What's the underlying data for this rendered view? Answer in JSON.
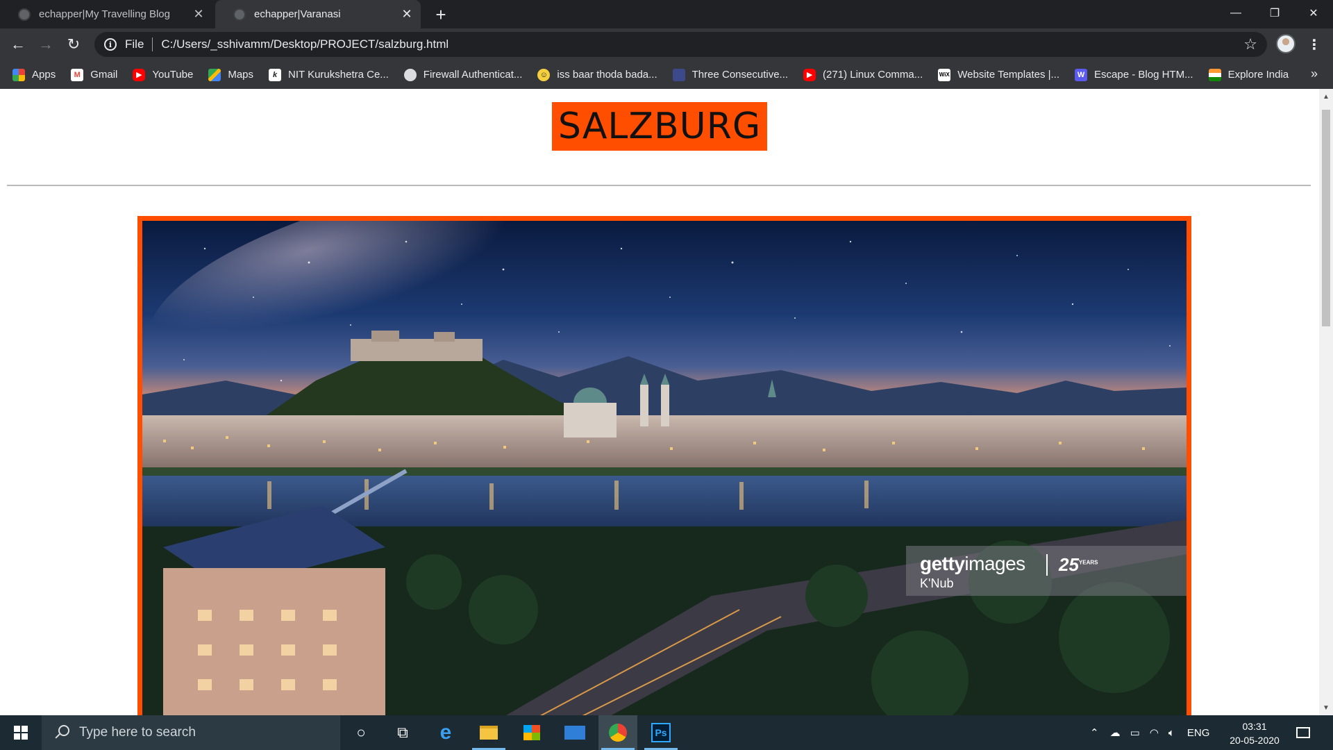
{
  "browser": {
    "tabs": [
      {
        "title": "echapper|My Travelling Blog",
        "active": false
      },
      {
        "title": "echapper|Varanasi",
        "active": true
      }
    ],
    "omnibox": {
      "scheme": "File",
      "url": "C:/Users/_sshivamm/Desktop/PROJECT/salzburg.html"
    },
    "bookmarks": [
      {
        "label": "Apps",
        "icon": "apps-grid-icon"
      },
      {
        "label": "Gmail",
        "icon": "gmail-icon"
      },
      {
        "label": "YouTube",
        "icon": "youtube-icon"
      },
      {
        "label": "Maps",
        "icon": "maps-icon"
      },
      {
        "label": "NIT Kurukshetra Ce...",
        "icon": "nit-icon"
      },
      {
        "label": "Firewall Authenticat...",
        "icon": "globe-icon"
      },
      {
        "label": "iss baar thoda bada...",
        "icon": "smiley-icon"
      },
      {
        "label": "Three Consecutive...",
        "icon": "page-icon"
      },
      {
        "label": "(271) Linux Comma...",
        "icon": "youtube-icon"
      },
      {
        "label": "Website Templates |...",
        "icon": "wix-icon"
      },
      {
        "label": "Escape - Blog HTM...",
        "icon": "w-icon"
      },
      {
        "label": "Explore India",
        "icon": "india-flag-icon"
      }
    ]
  },
  "page": {
    "title": "SALZBURG",
    "watermark": {
      "brand_bold": "getty",
      "brand_light": "images",
      "years": "25",
      "years_suffix": "YEARS",
      "credit": "K'Nub"
    }
  },
  "taskbar": {
    "search_placeholder": "Type here to search",
    "language": "ENG",
    "time": "03:31",
    "date": "20-05-2020"
  },
  "colors": {
    "accent": "#ff4e00",
    "chrome_dark": "#202124",
    "chrome_toolbar": "#35363a",
    "taskbar": "#1c2a33"
  }
}
